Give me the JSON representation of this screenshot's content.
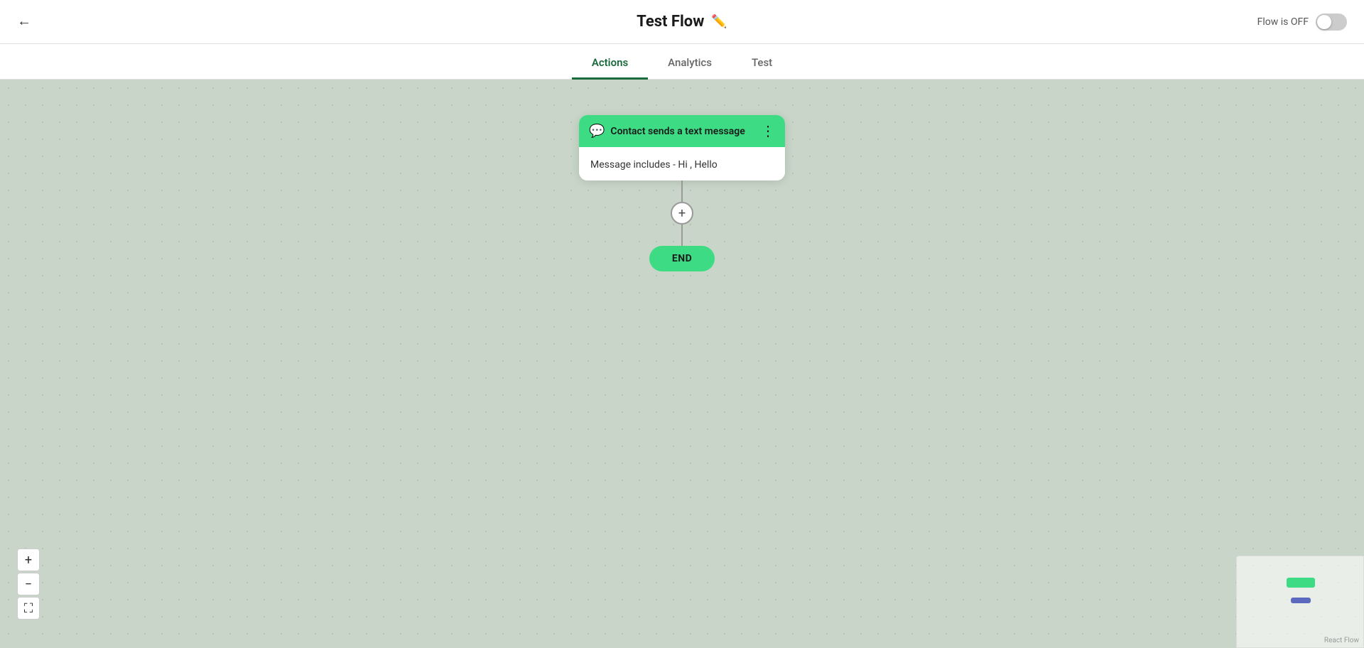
{
  "header": {
    "title": "Test Flow",
    "edit_icon": "✏️",
    "back_icon": "←",
    "flow_status_label": "Flow is OFF"
  },
  "tabs": [
    {
      "id": "actions",
      "label": "Actions",
      "active": true
    },
    {
      "id": "analytics",
      "label": "Analytics",
      "active": false
    },
    {
      "id": "test",
      "label": "Test",
      "active": false
    }
  ],
  "flow": {
    "trigger_node": {
      "icon": "💬",
      "title": "Contact sends a text message",
      "more_icon": "⋮",
      "condition": "Message includes - Hi , Hello"
    },
    "add_button_label": "+",
    "end_node_label": "END"
  },
  "zoom": {
    "zoom_in_label": "+",
    "zoom_out_label": "−",
    "fit_label": "⛶"
  },
  "minimap": {
    "react_flow_label": "React Flow"
  }
}
